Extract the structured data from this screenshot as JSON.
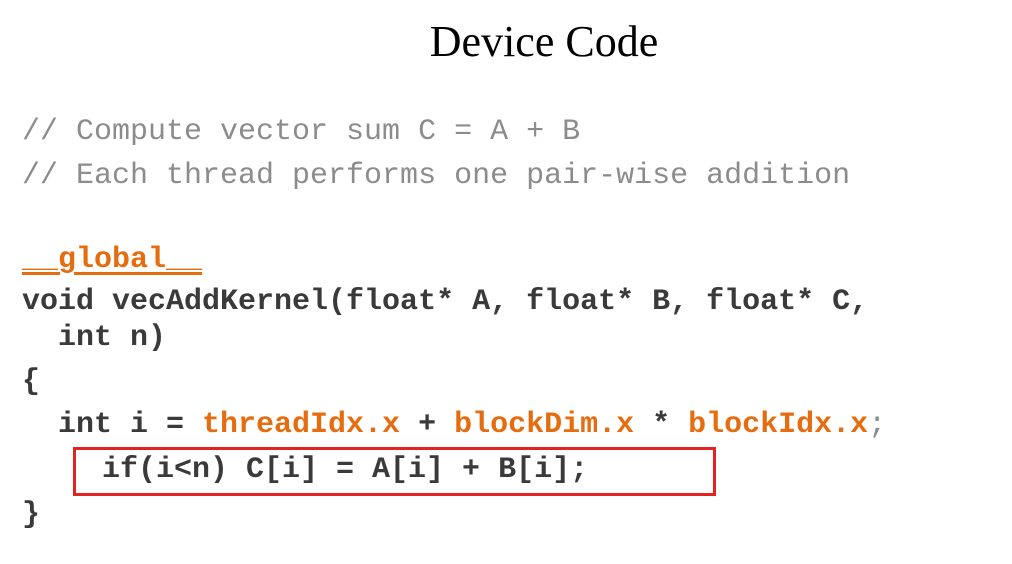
{
  "slide": {
    "title": "Device Code"
  },
  "code": {
    "comment_1": "// Compute vector sum C = A + B",
    "comment_2": "// Each thread performs one pair-wise addition",
    "qualifier": "__global__",
    "signature_1": "void vecAddKernel(float* A, float* B, float* C,",
    "signature_2": "  int n)",
    "open_brace": "{",
    "line_int_i": "  int i = ",
    "thread_idx": "threadIdx.x",
    "plus": " + ",
    "block_dim": "blockDim.x",
    "times": " * ",
    "block_idx": "blockIdx.x",
    "semicolon": ";",
    "if_line": "if(i<n) C[i] = A[i] + B[i];",
    "close_brace": "}"
  },
  "colors": {
    "comment": "#8c8c8c",
    "code": "#3a3a3a",
    "keyword_accent": "#e56d0f",
    "highlight_border": "#e32222"
  }
}
